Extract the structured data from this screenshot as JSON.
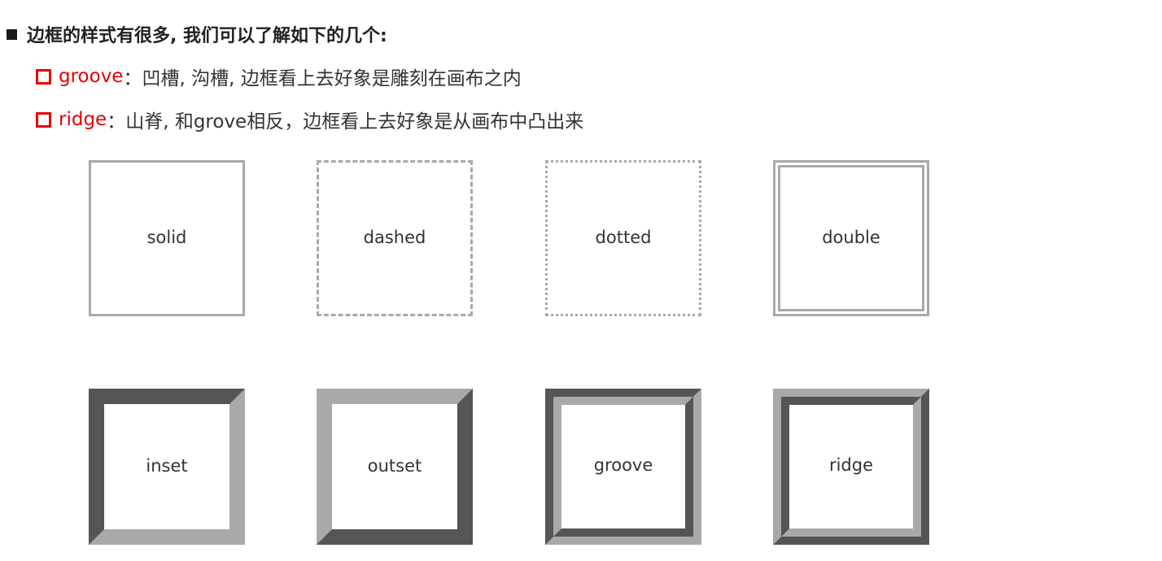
{
  "heading": "边框的样式有很多, 我们可以了解如下的几个:",
  "items": [
    {
      "term": "groove",
      "description": "：凹槽, 沟槽, 边框看上去好象是雕刻在画布之内"
    },
    {
      "term": "ridge",
      "description": "：山脊, 和grove相反，边框看上去好象是从画布中凸出来"
    }
  ],
  "boxes": [
    {
      "label": "solid"
    },
    {
      "label": "dashed"
    },
    {
      "label": "dotted"
    },
    {
      "label": "double"
    },
    {
      "label": "inset"
    },
    {
      "label": "outset"
    },
    {
      "label": "groove"
    },
    {
      "label": "ridge"
    }
  ],
  "colors": {
    "accent": "#e60000",
    "border_gray": "#a9a9a9",
    "text": "#333333"
  },
  "icons": {
    "heading_bullet": "filled-square-icon",
    "item_bullet": "hollow-square-icon"
  }
}
